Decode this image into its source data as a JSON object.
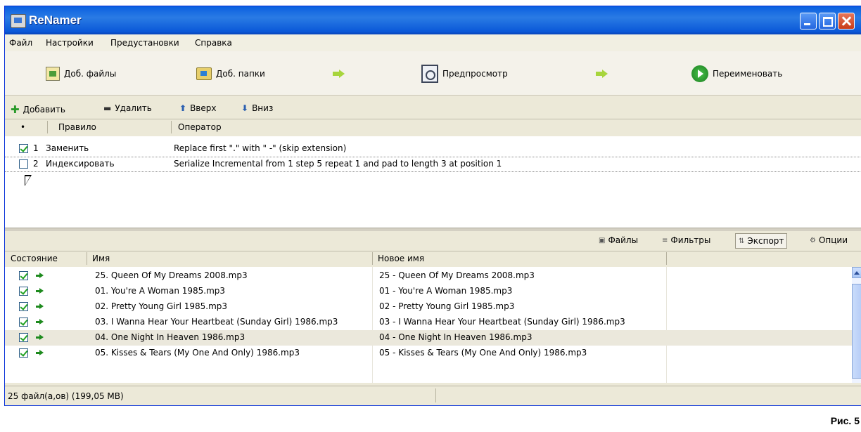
{
  "window": {
    "title": "ReNamer"
  },
  "menu": [
    "Файл",
    "Настройки",
    "Предустановки",
    "Справка"
  ],
  "toolbar": {
    "add_files": "Доб. файлы",
    "add_folders": "Доб. папки",
    "preview": "Предпросмотр",
    "rename": "Переименовать"
  },
  "rule_actions": {
    "add": "Добавить",
    "remove": "Удалить",
    "up": "Вверх",
    "down": "Вниз"
  },
  "rules_header": {
    "marker": "•",
    "rule": "Правило",
    "operator": "Оператор"
  },
  "rules": [
    {
      "index": "1",
      "checked": true,
      "name": "Заменить",
      "operator": "Replace first \".\" with \" -\" (skip extension)"
    },
    {
      "index": "2",
      "checked": false,
      "name": "Индексировать",
      "operator": "Serialize Incremental from 1 step 5 repeat 1 and pad to length 3 at position 1"
    }
  ],
  "tabs": {
    "files": "Файлы",
    "filters": "Фильтры",
    "export": "Экспорт",
    "options": "Опции"
  },
  "files_header": {
    "state": "Состояние",
    "name": "Имя",
    "new_name": "Новое имя"
  },
  "files": [
    {
      "checked": true,
      "name": "25. Queen Of My Dreams 2008.mp3",
      "new_name": "25 - Queen Of My Dreams 2008.mp3"
    },
    {
      "checked": true,
      "name": "01. You're A Woman 1985.mp3",
      "new_name": "01 - You're A Woman 1985.mp3"
    },
    {
      "checked": true,
      "name": "02. Pretty Young Girl 1985.mp3",
      "new_name": "02 - Pretty Young Girl 1985.mp3"
    },
    {
      "checked": true,
      "name": "03. I Wanna Hear Your Heartbeat (Sunday Girl) 1986.mp3",
      "new_name": "03 - I Wanna Hear Your Heartbeat (Sunday Girl) 1986.mp3"
    },
    {
      "checked": true,
      "name": "04. One Night In Heaven 1986.mp3",
      "new_name": "04 - One Night In Heaven 1986.mp3"
    },
    {
      "checked": true,
      "name": "05. Kisses & Tears (My One And Only) 1986.mp3",
      "new_name": "05 - Kisses & Tears (My One And Only) 1986.mp3"
    }
  ],
  "status": {
    "text": "25 файл(а,ов) (199,05 MB)"
  },
  "caption": "Рис. 5",
  "colors": {
    "title_bar": "#0a5fe0",
    "check": "#21a121",
    "flow_arrow": "#a7d53c",
    "row_highlight": "#ebe8dc"
  }
}
